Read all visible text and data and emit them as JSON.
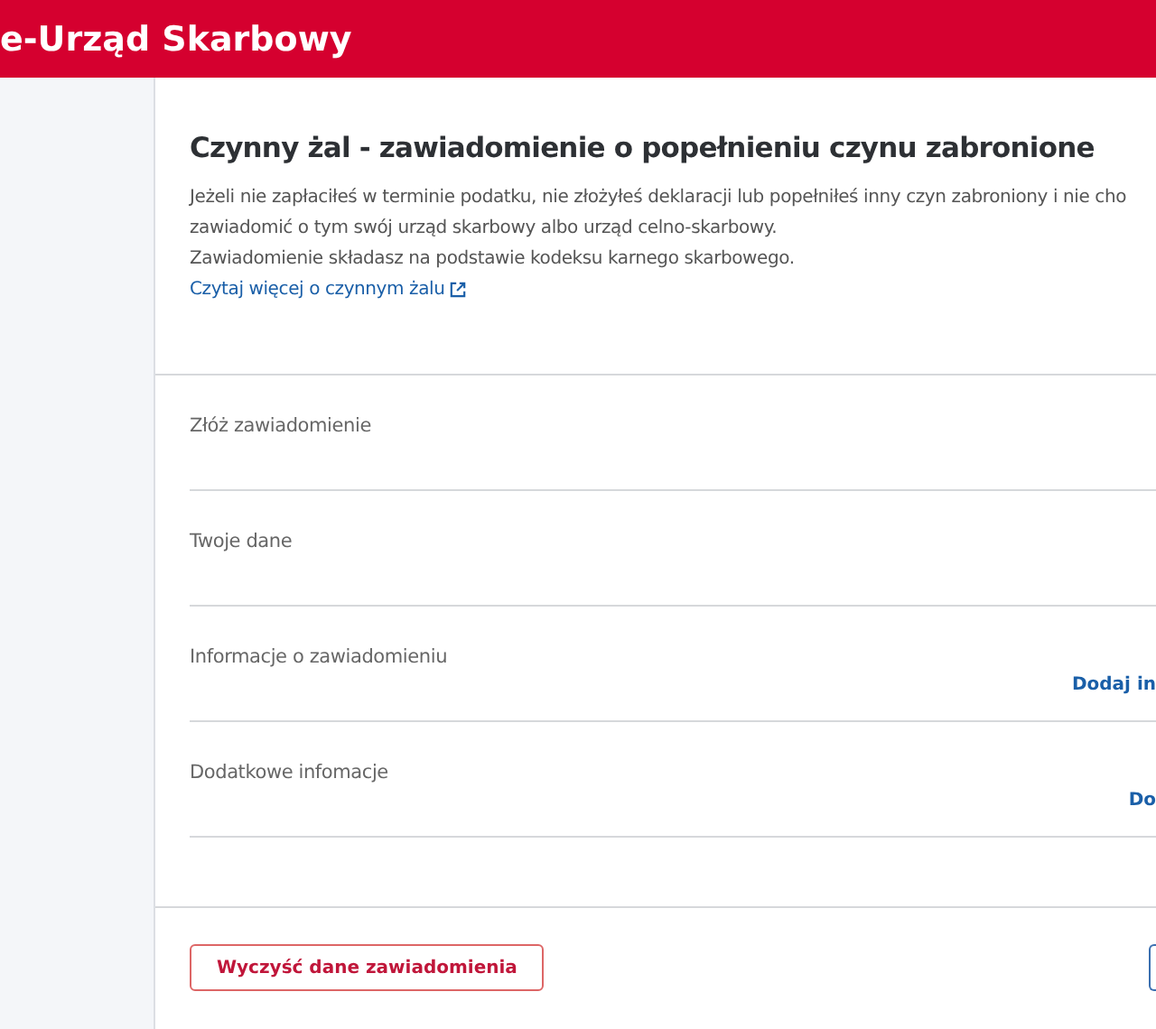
{
  "header": {
    "title": "e-Urząd Skarbowy"
  },
  "page": {
    "title": "Czynny żal - zawiadomienie o popełnieniu czynu zabronione",
    "intro_lines": [
      "Jeżeli nie zapłaciłeś w terminie podatku, nie złożyłeś deklaracji lub popełniłeś inny czyn zabroniony i nie cho",
      "zawiadomić o tym swój urząd skarbowy albo urząd celno-skarbowy.",
      "Zawiadomienie składasz na podstawie kodeksu karnego skarbowego."
    ],
    "link": "Czytaj więcej o czynnym żalu"
  },
  "sections": [
    {
      "label": "Złóż zawiadomienie"
    },
    {
      "label": "Twoje dane"
    },
    {
      "label": "Informacje o zawiadomieniu",
      "action": "Dodaj in"
    },
    {
      "label": "Dodatkowe infomacje",
      "action": "Do"
    }
  ],
  "footer": {
    "clear_button": "Wyczyść dane zawiadomienia"
  }
}
